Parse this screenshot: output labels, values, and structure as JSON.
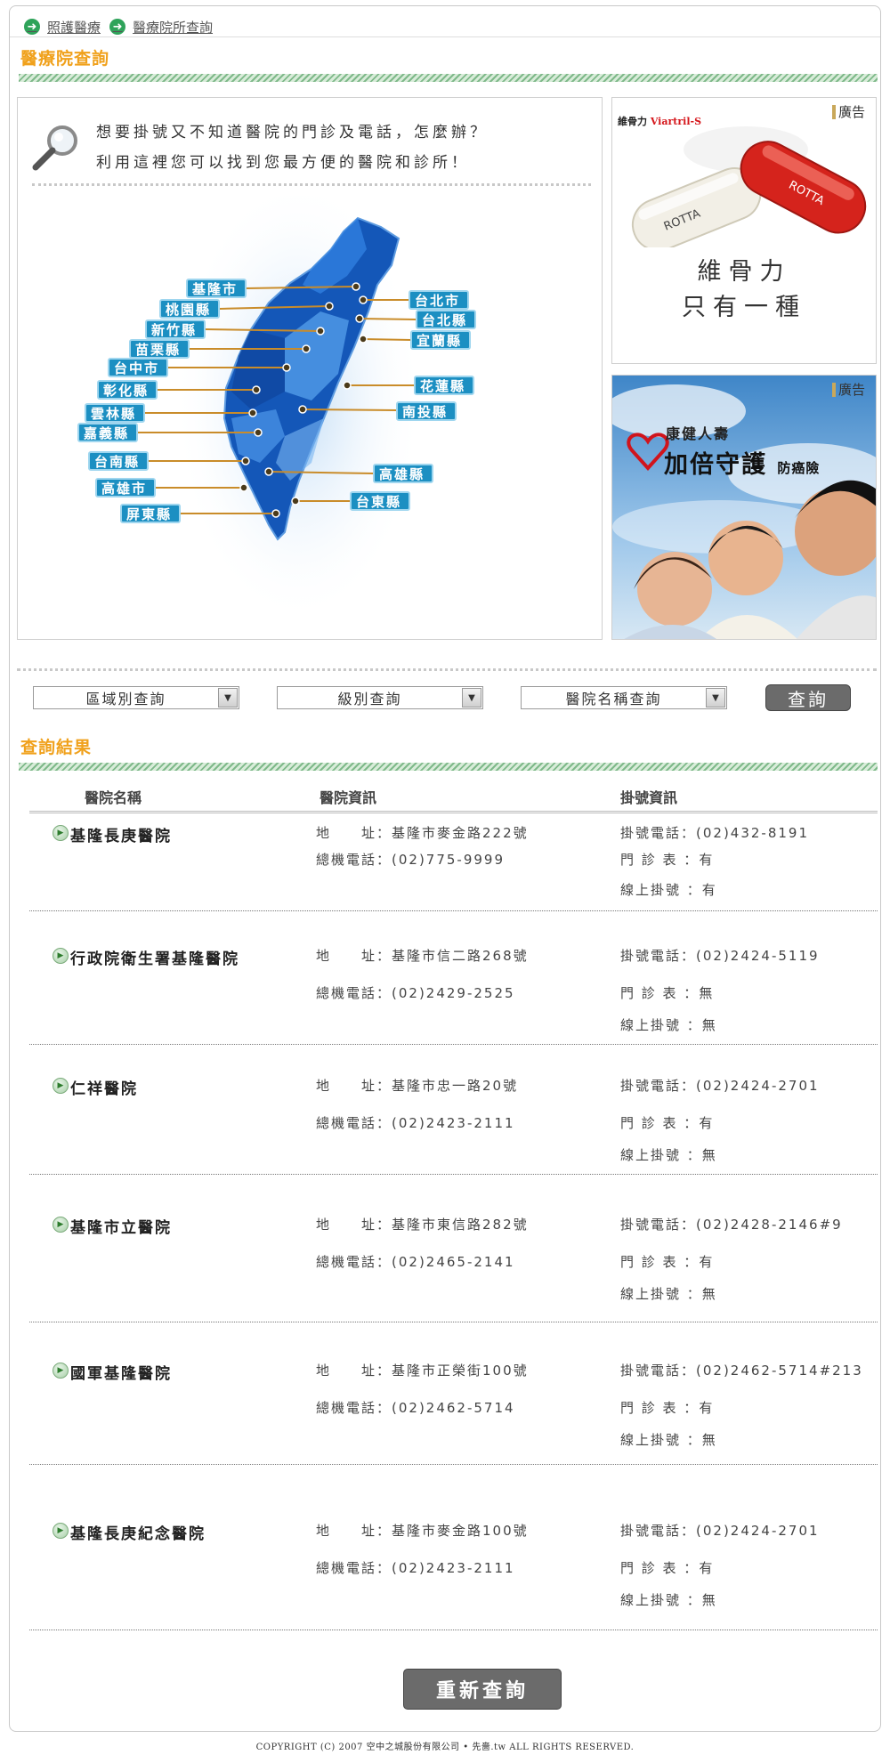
{
  "breadcrumb": {
    "items": [
      "照護醫療",
      "醫療院所查詢"
    ]
  },
  "section_titles": {
    "hospital_search": "醫療院查詢",
    "results": "查詢結果"
  },
  "intro": {
    "line1": "想要掛號又不知道醫院的門診及電話，怎麼辦？",
    "line2": "利用這裡您可以找到您最方便的醫院和診所！"
  },
  "map": {
    "counties": [
      "基隆市",
      "台北市",
      "桃園縣",
      "台北縣",
      "新竹縣",
      "宜蘭縣",
      "苗栗縣",
      "台中市",
      "花蓮縣",
      "彰化縣",
      "雲林縣",
      "南投縣",
      "嘉義縣",
      "台南縣",
      "高雄縣",
      "高雄市",
      "台東縣",
      "屏東縣"
    ]
  },
  "ads": {
    "label": "廣告",
    "ad1": {
      "brand_zh": "維骨力",
      "brand_en": "Viartril-S",
      "capsule_text": "ROTTA",
      "slogan_line1": "維骨力",
      "slogan_line2": "只有一種"
    },
    "ad2": {
      "company": "康健人壽",
      "product": "加倍守護",
      "product_suffix": "防癌險"
    }
  },
  "search": {
    "region_select": "區域別查詢",
    "level_select": "級別查詢",
    "name_select": "醫院名稱查詢",
    "query_button": "查詢"
  },
  "results": {
    "headers": {
      "name": "醫院名稱",
      "info": "醫院資訊",
      "registration": "掛號資訊"
    },
    "labels": {
      "address": "地　　址：",
      "main_phone": "總機電話：",
      "reg_phone": "掛號電話：",
      "schedule": "門 診 表 ：",
      "online": "線上掛號 ："
    },
    "hospitals": [
      {
        "name": "基隆長庚醫院",
        "address": "基隆市麥金路222號",
        "main_phone": "(02)775-9999",
        "reg_phone": "(02)432-8191",
        "schedule": "有",
        "online": "有"
      },
      {
        "name": "行政院衛生署基隆醫院",
        "address": "基隆市信二路268號",
        "main_phone": "(02)2429-2525",
        "reg_phone": "(02)2424-5119",
        "schedule": "無",
        "online": "無"
      },
      {
        "name": "仁祥醫院",
        "address": "基隆市忠一路20號",
        "main_phone": "(02)2423-2111",
        "reg_phone": "(02)2424-2701",
        "schedule": "有",
        "online": "無"
      },
      {
        "name": "基隆市立醫院",
        "address": "基隆市東信路282號",
        "main_phone": "(02)2465-2141",
        "reg_phone": "(02)2428-2146#9",
        "schedule": "有",
        "online": "無"
      },
      {
        "name": "國軍基隆醫院",
        "address": "基隆市正榮街100號",
        "main_phone": "(02)2462-5714",
        "reg_phone": "(02)2462-5714#213",
        "schedule": "有",
        "online": "無"
      },
      {
        "name": "基隆長庚紀念醫院",
        "address": "基隆市麥金路100號",
        "main_phone": "(02)2423-2111",
        "reg_phone": "(02)2424-2701",
        "schedule": "有",
        "online": "無"
      }
    ],
    "reset_button": "重新查詢"
  },
  "footer": {
    "copyright": "COPYRIGHT (C) 2007 空中之城股份有限公司 • 先嗇.tw ALL RIGHTS RESERVED."
  },
  "colors": {
    "accent_orange": "#f0a11c",
    "map_label_blue": "#1c8fc2",
    "button_gray": "#6b6b6b",
    "hatch_green": "#7fb98a"
  }
}
